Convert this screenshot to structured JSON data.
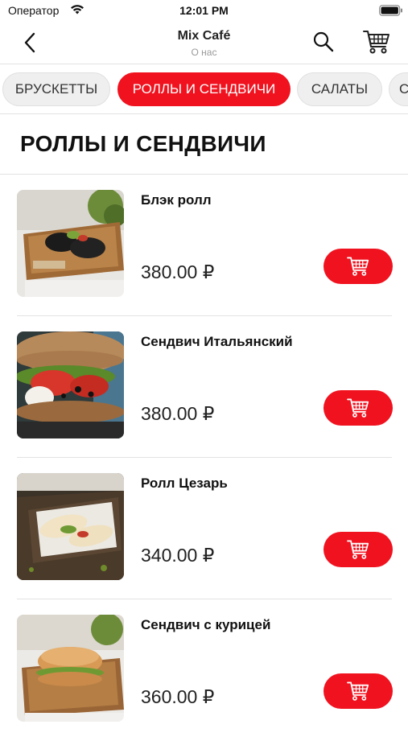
{
  "status_bar": {
    "carrier": "Оператор",
    "time": "12:01 PM"
  },
  "nav": {
    "title": "Mix Café",
    "subtitle": "О нас"
  },
  "categories": [
    {
      "label": "БРУСКЕТТЫ",
      "active": false
    },
    {
      "label": "РОЛЛЫ И СЕНДВИЧИ",
      "active": true
    },
    {
      "label": "САЛАТЫ",
      "active": false
    },
    {
      "label": "С",
      "active": false
    }
  ],
  "section": {
    "title": "РОЛЛЫ И СЕНДВИЧИ"
  },
  "items": [
    {
      "name": "Блэк ролл",
      "price": "380.00 ₽"
    },
    {
      "name": "Сендвич Итальянский",
      "price": "380.00 ₽"
    },
    {
      "name": "Ролл Цезарь",
      "price": "340.00 ₽"
    },
    {
      "name": "Сендвич с курицей",
      "price": "360.00 ₽"
    }
  ],
  "colors": {
    "accent": "#f0121f",
    "divider": "#e2e2e2",
    "tab_bg": "#efefef"
  },
  "icons": {
    "back": "chevron-left-icon",
    "search": "search-icon",
    "cart": "shopping-cart-icon",
    "wifi": "wifi-icon",
    "battery": "battery-icon"
  }
}
